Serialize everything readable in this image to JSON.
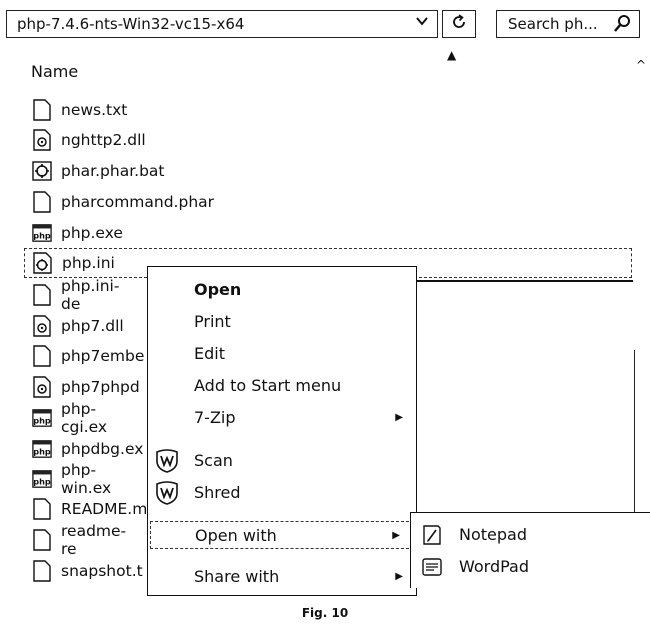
{
  "address": {
    "path": "php-7.4.6-nts-Win32-vc15-x64"
  },
  "search": {
    "placeholder": "Search ph..."
  },
  "columns": {
    "name": "Name"
  },
  "files": [
    {
      "name": "news.txt",
      "icon": "text-file-icon"
    },
    {
      "name": "nghttp2.dll",
      "icon": "dll-file-icon"
    },
    {
      "name": "phar.phar.bat",
      "icon": "batch-file-icon"
    },
    {
      "name": "pharcommand.phar",
      "icon": "blank-file-icon"
    },
    {
      "name": "php.exe",
      "icon": "php-exe-icon"
    },
    {
      "name": "php.ini",
      "icon": "ini-file-icon",
      "selected": true
    },
    {
      "name": "php.ini-de",
      "icon": "blank-file-icon"
    },
    {
      "name": "php7.dll",
      "icon": "dll-file-icon"
    },
    {
      "name": "php7embe",
      "icon": "blank-file-icon"
    },
    {
      "name": "php7phpd",
      "icon": "dll-file-icon"
    },
    {
      "name": "php-cgi.ex",
      "icon": "php-exe-icon"
    },
    {
      "name": "phpdbg.ex",
      "icon": "php-exe-icon"
    },
    {
      "name": "php-win.ex",
      "icon": "php-exe-icon"
    },
    {
      "name": "README.m",
      "icon": "blank-file-icon"
    },
    {
      "name": "readme-re",
      "icon": "blank-file-icon"
    },
    {
      "name": "snapshot.t",
      "icon": "blank-file-icon"
    }
  ],
  "context_menu": {
    "items": [
      {
        "label": "Open",
        "bold": true
      },
      {
        "label": "Print"
      },
      {
        "label": "Edit"
      },
      {
        "label": "Add to Start menu"
      },
      {
        "label": "7-Zip",
        "submenu": true
      },
      {
        "label": "Scan",
        "icon": "shield-icon"
      },
      {
        "label": "Shred",
        "icon": "shield-icon"
      },
      {
        "label": "Open with",
        "submenu": true,
        "highlighted": true
      },
      {
        "label": "Share with",
        "submenu": true
      }
    ]
  },
  "open_with_submenu": {
    "items": [
      {
        "label": "Notepad",
        "icon": "notepad-icon"
      },
      {
        "label": "WordPad",
        "icon": "wordpad-icon"
      }
    ]
  },
  "caption": "Fig. 10"
}
